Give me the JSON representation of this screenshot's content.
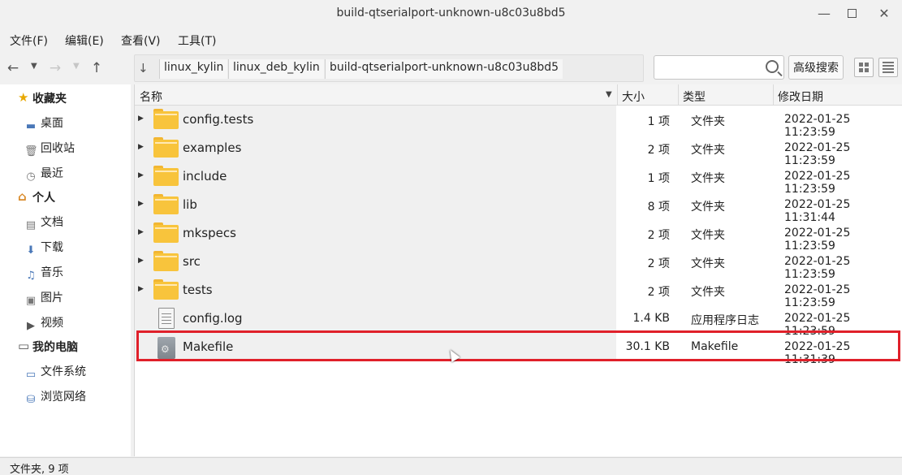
{
  "window": {
    "title": "build-qtserialport-unknown-u8c03u8bd5"
  },
  "menu": {
    "file": "文件(F)",
    "edit": "编辑(E)",
    "view": "查看(V)",
    "tools": "工具(T)"
  },
  "toolbar": {
    "path": [
      "linux_kylin",
      "linux_deb_kylin",
      "build-qtserialport-unknown-u8c03u8bd5"
    ],
    "search_placeholder": "",
    "advanced_search": "高级搜索"
  },
  "sidebar": {
    "favorites": {
      "label": "收藏夹",
      "items": [
        "桌面",
        "回收站",
        "最近"
      ]
    },
    "personal": {
      "label": "个人",
      "items": [
        "文档",
        "下载",
        "音乐",
        "图片",
        "视频"
      ]
    },
    "computer": {
      "label": "我的电脑",
      "items": [
        "文件系统",
        "浏览网络"
      ]
    }
  },
  "columns": {
    "name": "名称",
    "size": "大小",
    "type": "类型",
    "modified": "修改日期"
  },
  "files": [
    {
      "name": "config.tests",
      "size": "1 项",
      "type": "文件夹",
      "modified": "2022-01-25 11:23:59",
      "kind": "folder"
    },
    {
      "name": "examples",
      "size": "2 项",
      "type": "文件夹",
      "modified": "2022-01-25 11:23:59",
      "kind": "folder"
    },
    {
      "name": "include",
      "size": "1 项",
      "type": "文件夹",
      "modified": "2022-01-25 11:23:59",
      "kind": "folder"
    },
    {
      "name": "lib",
      "size": "8 项",
      "type": "文件夹",
      "modified": "2022-01-25 11:31:44",
      "kind": "folder"
    },
    {
      "name": "mkspecs",
      "size": "2 项",
      "type": "文件夹",
      "modified": "2022-01-25 11:23:59",
      "kind": "folder"
    },
    {
      "name": "src",
      "size": "2 项",
      "type": "文件夹",
      "modified": "2022-01-25 11:23:59",
      "kind": "folder"
    },
    {
      "name": "tests",
      "size": "2 项",
      "type": "文件夹",
      "modified": "2022-01-25 11:23:59",
      "kind": "folder"
    },
    {
      "name": "config.log",
      "size": "1.4 KB",
      "type": "应用程序日志",
      "modified": "2022-01-25 11:23:59",
      "kind": "text-file"
    },
    {
      "name": "Makefile",
      "size": "30.1 KB",
      "type": "Makefile",
      "modified": "2022-01-25 11:31:39",
      "kind": "makefile"
    }
  ],
  "status": {
    "text": "文件夹, 9 项"
  },
  "colors": {
    "highlight": "#e0202a",
    "folder": "#f8c43c"
  }
}
